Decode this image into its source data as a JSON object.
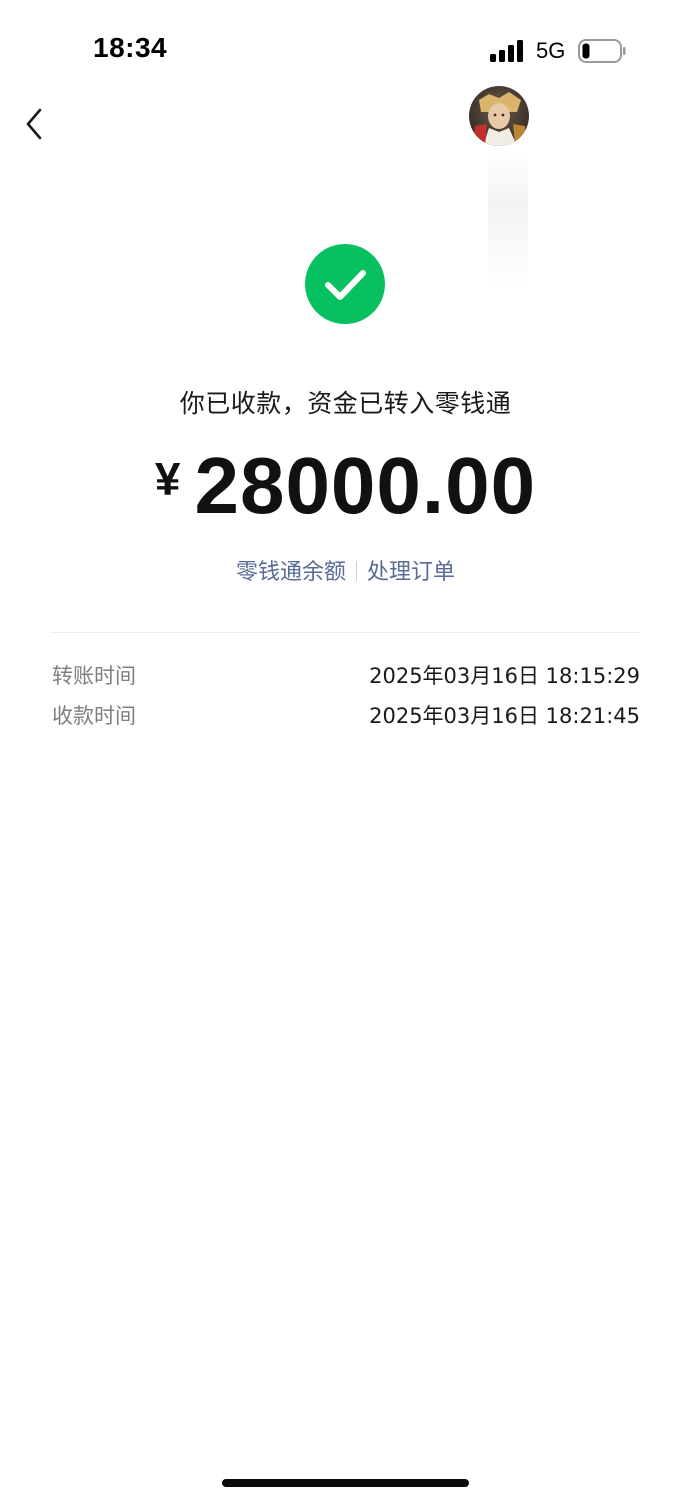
{
  "status_bar": {
    "time": "18:34",
    "network": "5G",
    "signal_icon": "signal-bars-icon",
    "battery_icon": "battery-low-icon"
  },
  "nav": {
    "back_icon": "chevron-left-icon"
  },
  "result": {
    "icon": "check-circle-icon",
    "icon_color": "#07c160",
    "message": "你已收款，资金已转入零钱通",
    "currency_symbol": "¥",
    "amount": "28000.00"
  },
  "links": {
    "balance": "零钱通余额",
    "handle_order": "处理订单",
    "color": "#576b95"
  },
  "details": [
    {
      "label": "转账时间",
      "value": "2025年03月16日 18:15:29"
    },
    {
      "label": "收款时间",
      "value": "2025年03月16日 18:21:45"
    }
  ]
}
